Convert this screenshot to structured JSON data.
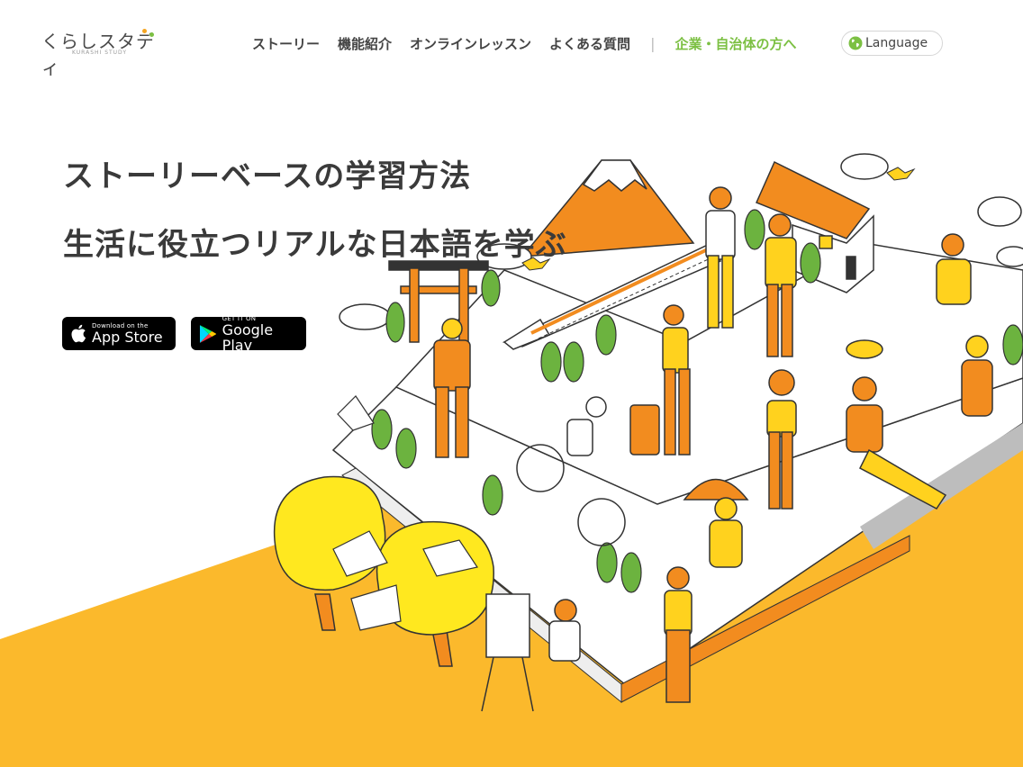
{
  "brand": {
    "logo_text": "くらしスタディ",
    "logo_sub": "KURASHI STUDY"
  },
  "nav": {
    "items": [
      "ストーリー",
      "機能紹介",
      "オンラインレッスン",
      "よくある質問"
    ],
    "separator": "|",
    "business_link": "企業・自治体の方へ",
    "language_label": "Language"
  },
  "hero": {
    "title": "ストーリーベースの学習方法",
    "subtitle": "生活に役立つリアルな日本語を学ぶ"
  },
  "stores": {
    "apple": {
      "small": "Download on the",
      "big": "App Store",
      "icon": "apple-icon"
    },
    "google": {
      "small": "GET IT ON",
      "big": "Google Play",
      "icon": "google-play-icon"
    }
  },
  "colors": {
    "accent_green": "#7cc043",
    "orange": "#f28c1f",
    "yellow": "#ffd21e",
    "background_orange": "#fbb92c"
  }
}
